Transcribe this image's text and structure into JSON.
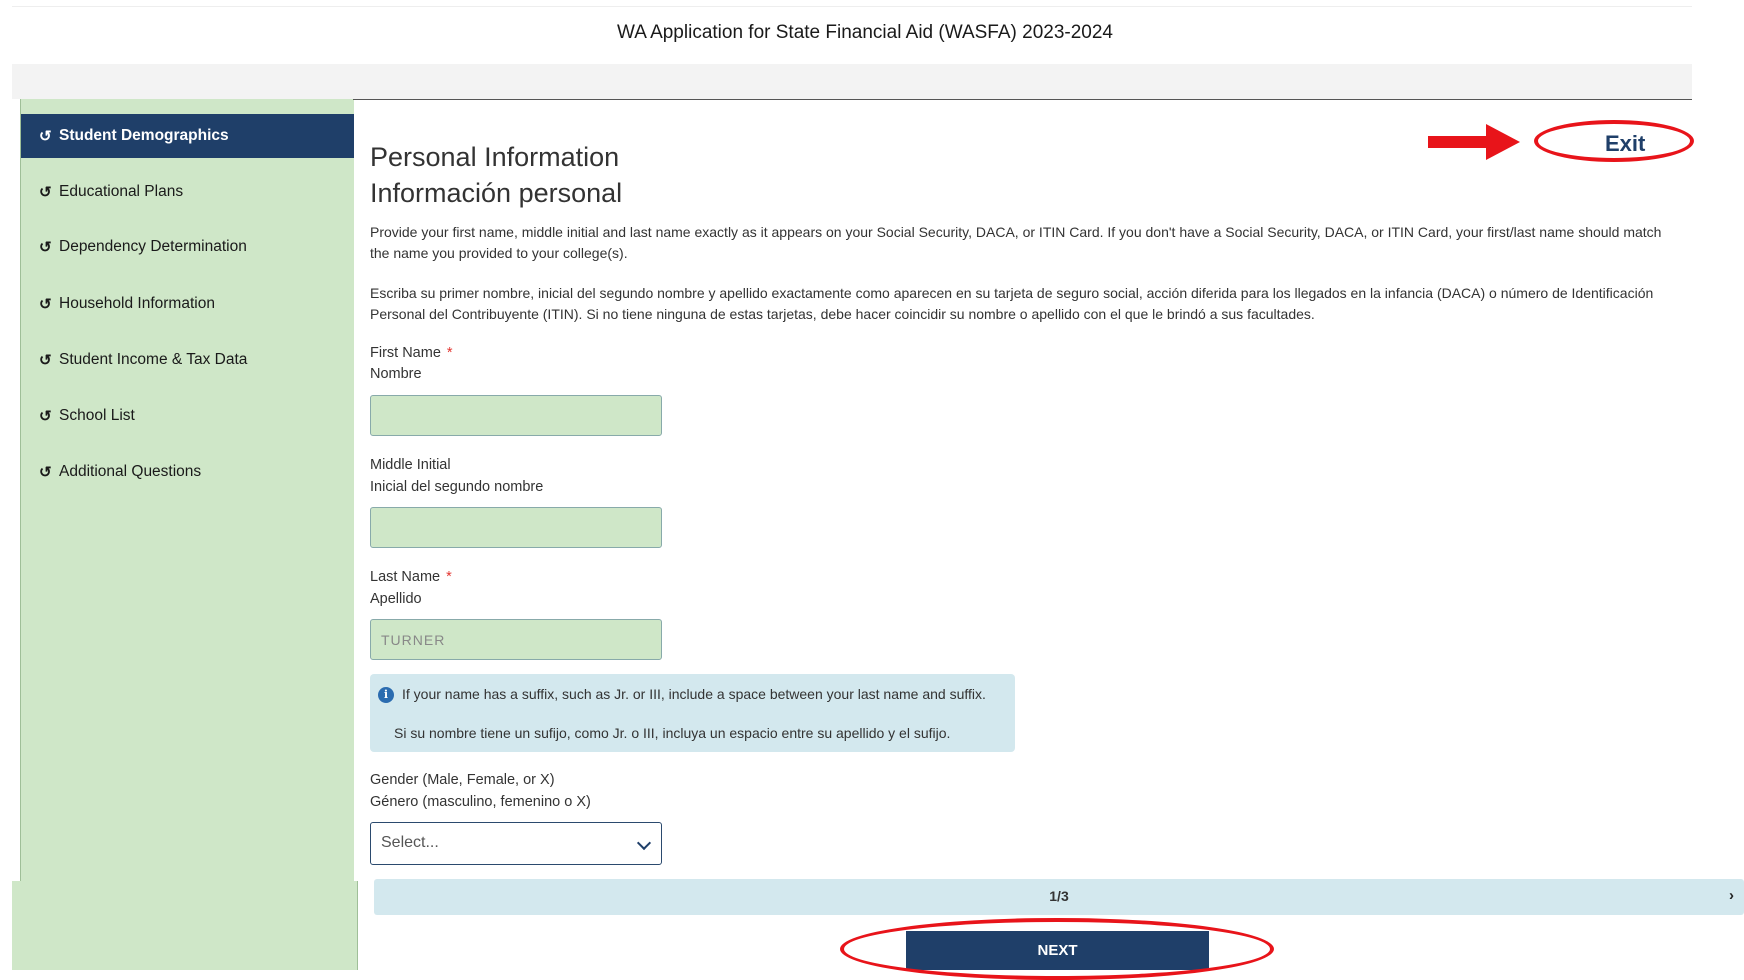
{
  "app": {
    "title": "WA Application for State Financial Aid (WASFA) 2023-2024"
  },
  "sidebar": {
    "items": [
      {
        "label": "Student Demographics",
        "icon": "history-icon",
        "active": true
      },
      {
        "label": "Educational Plans",
        "icon": "history-icon"
      },
      {
        "label": "Dependency Determination",
        "icon": "history-icon"
      },
      {
        "label": "Household Information",
        "icon": "history-icon"
      },
      {
        "label": "Student Income & Tax Data",
        "icon": "history-icon"
      },
      {
        "label": "School List",
        "icon": "history-icon"
      },
      {
        "label": "Additional Questions",
        "icon": "history-icon"
      }
    ],
    "icon_glyph": "↺"
  },
  "header": {
    "exit_label": "Exit"
  },
  "main": {
    "title_en": "Personal Information",
    "title_es": "Información personal",
    "instructions_en": "Provide your first name, middle initial and last name exactly as it appears on your Social Security, DACA, or ITIN Card. If you don't have a Social Security, DACA, or ITIN Card, your first/last name should match the name you provided to your college(s).",
    "instructions_es": "Escriba su primer nombre, inicial del segundo nombre y apellido exactamente como aparecen en su tarjeta de seguro social, acción diferida para los llegados en la infancia (DACA) o número de Identificación Personal del Contribuyente (ITIN). Si no tiene ninguna de estas tarjetas, debe hacer coincidir su nombre o apellido con el que le brindó a sus facultades.",
    "fields": {
      "first_name": {
        "label_en": "First Name",
        "label_es": "Nombre",
        "required_mark": "*",
        "value": ""
      },
      "middle_initial": {
        "label_en": "Middle Initial",
        "label_es": "Inicial del segundo nombre",
        "value": ""
      },
      "last_name": {
        "label_en": "Last Name",
        "label_es": "Apellido",
        "required_mark": "*",
        "value": "TURNER"
      }
    },
    "info": {
      "text_en": "If your name has a suffix, such as Jr. or III, include a space between your last name and suffix.",
      "text_es": "Si su nombre tiene un sufijo, como Jr. o III, incluya un espacio entre su apellido y el sufijo."
    },
    "gender": {
      "label_en": "Gender (Male, Female, or X)",
      "label_es": "Género (masculino, femenino o X)",
      "placeholder": "Select..."
    }
  },
  "pager": {
    "text": "1/3",
    "next_glyph": "›"
  },
  "footer": {
    "next_label": "NEXT"
  },
  "colors": {
    "sidebar_bg": "#cfe7c8",
    "active_nav": "#1f3f69",
    "annotation_red": "#e8141a",
    "info_bg": "#d3e8ee"
  }
}
